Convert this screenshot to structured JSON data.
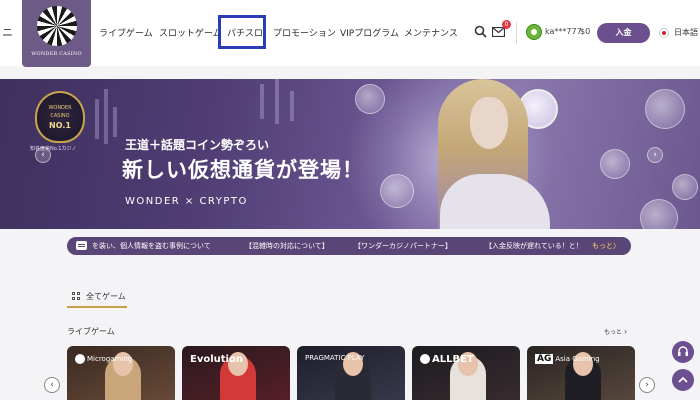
{
  "header": {
    "menu_stub": "ニ",
    "logo_text": "WONDER CASINO",
    "nav": [
      "ライブゲーム",
      "スロットゲーム",
      "パチスロ",
      "プロモーション",
      "VIPプログラム",
      "メンテナンス"
    ],
    "mail_badge": "0",
    "username": "ka***777",
    "balance": "$0",
    "deposit_label": "入金",
    "language": "日本語"
  },
  "banner": {
    "crest_line1": "WONDER",
    "crest_line2": "CASINO",
    "crest_line3": "NO.1",
    "crest_caption": "知名度第No.1カジノ",
    "subtitle": "王道＋話題コイン勢ぞろい",
    "title": "新しい仮想通貨が登場！",
    "tagline": "WONDER × CRYPTO",
    "prev": "‹",
    "next": "›"
  },
  "notice": {
    "items": [
      "を装い、個人情報を盗む事例について",
      "【混雑時の対応について】",
      "【ワンダーカジノパートナー】",
      "【入金反映が遅れている！と！"
    ],
    "more": "もっと〉"
  },
  "games": {
    "tab_label": "全てゲーム",
    "section_title": "ライブゲーム",
    "see_more": "もっと",
    "providers": [
      "Microgaming",
      "Evolution",
      "PRAGMATIC PLAY",
      "ALLBET",
      "Asia Gaming"
    ],
    "ag_mark": "AG",
    "prev": "‹",
    "next": "›"
  },
  "floating": {
    "support_icon": "headset-icon",
    "top_icon": "chevron-up-icon"
  },
  "colors": {
    "brand_purple": "#6b4f8e",
    "highlight_box": "#2b3bb5",
    "tab_underline": "#c9a14b"
  }
}
